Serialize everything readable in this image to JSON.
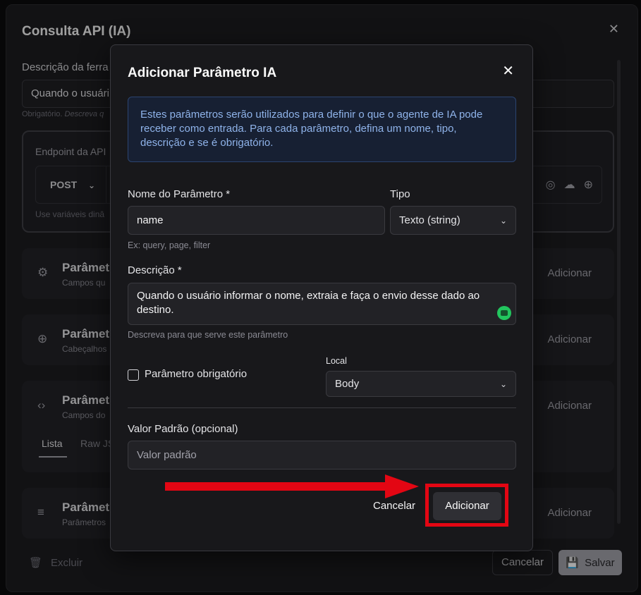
{
  "background": {
    "title": "Consulta API (IA)",
    "description_label": "Descrição da ferra",
    "description_value": "Quando o usuári",
    "description_hint_prefix": "Obrigatório.",
    "description_hint_italic": "Descreva q",
    "endpoint_label": "Endpoint da API",
    "method": "POST",
    "endpoint_hint": "Use variáveis dinâ",
    "sections": [
      {
        "title": "Parâmet",
        "subtitle": "Campos qu",
        "action": "Adicionar",
        "icon": "gear-icon"
      },
      {
        "title": "Parâmet",
        "subtitle": "Cabeçalhos",
        "action": "Adicionar",
        "icon": "globe-icon"
      },
      {
        "title": "Parâmet",
        "subtitle": "Campos do",
        "action": "Adicionar",
        "icon": "code-icon",
        "tabs": [
          "Lista",
          "Raw JS"
        ]
      },
      {
        "title": "Parâmet",
        "subtitle": "Parâmetros",
        "action": "Adicionar",
        "icon": "list-plus-icon"
      }
    ],
    "delete_label": "Excluir",
    "cancel_label": "Cancelar",
    "save_label": "Salvar"
  },
  "dialog": {
    "title": "Adicionar Parâmetro IA",
    "info_text": "Estes parâmetros serão utilizados para definir o que o agente de IA pode receber como entrada. Para cada parâmetro, defina um nome, tipo, descrição e se é obrigatório.",
    "name_label": "Nome do Parâmetro *",
    "name_value": "name",
    "name_hint": "Ex: query, page, filter",
    "type_label": "Tipo",
    "type_value": "Texto (string)",
    "description_label": "Descrição *",
    "description_value": "Quando o usuário informar o nome, extraia e faça o envio desse dado ao destino.",
    "description_hint": "Descreva para que serve este parâmetro",
    "required_label": "Parâmetro obrigatório",
    "required_checked": false,
    "location_label": "Local",
    "location_value": "Body",
    "default_label": "Valor Padrão (opcional)",
    "default_placeholder": "Valor padrão",
    "cancel_label": "Cancelar",
    "add_label": "Adicionar"
  },
  "colors": {
    "annotation_red": "#e30613",
    "info_bg": "#172033",
    "info_text": "#8fb3ea"
  }
}
